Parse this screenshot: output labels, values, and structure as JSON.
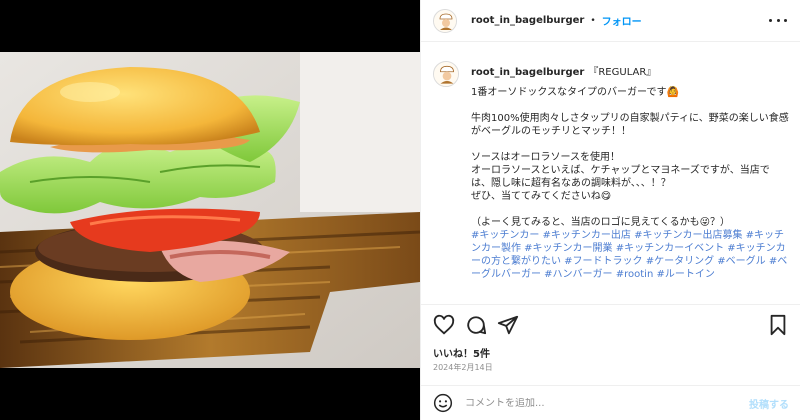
{
  "post": {
    "username": "root_in_bagelburger",
    "separator": "•",
    "follow_label": "フォロー",
    "more_icon": "more-horizontal-icon"
  },
  "caption": {
    "username": "root_in_bagelburger",
    "tag": "『REGULAR』",
    "text": "1番オーソドックスなタイプのバーガーです🙆\n\n牛肉100%使用肉々しさタップリの自家製パティに、野菜の楽しい食感がベーグルのモッチリとマッチ！！\n\nソースはオーロラソースを使用！\nオーロラソースといえば、ケチャップとマヨネーズですが、当店では、隠し味に超有名なあの調味料が、、、！？\nぜひ、当ててみてくださいね😋\n\n（よーく見てみると、当店のロゴに見えてくるかも😜？）\n",
    "hashtags": "#キッチンカー #キッチンカー出店 #キッチンカー出店募集 #キッチンカー製作 #キッチンカー開業 #キッチンカーイベント #キッチンカーの方と繋がりたい #フードトラック #ケータリング #ベーグル #ベーグルバーガー #ハンバーガー #rootin #ルートイン"
  },
  "actions": {
    "like_icon": "heart-icon",
    "comment_icon": "comment-icon",
    "share_icon": "share-icon",
    "save_icon": "bookmark-icon"
  },
  "likes_label": "いいね！5件",
  "date_label": "2024年2月14日",
  "comment": {
    "emoji_icon": "smiley-icon",
    "placeholder": "コメントを追加...",
    "post_label": "投稿する"
  },
  "colors": {
    "accent": "#0095f6",
    "hashtag": "#4c7dd1",
    "muted": "#8e8e8e",
    "post_disabled": "#b2dffc"
  }
}
